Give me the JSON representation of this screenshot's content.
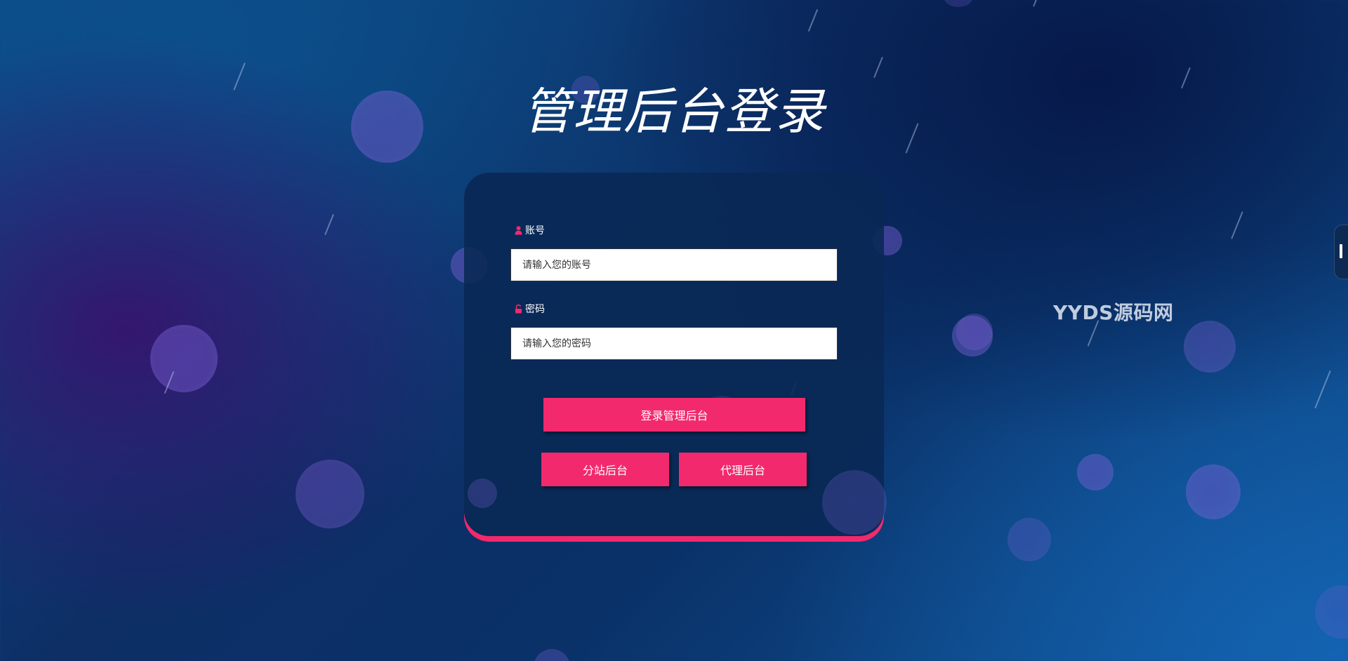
{
  "page": {
    "title": "管理后台登录",
    "watermark": "YYDS源码网"
  },
  "form": {
    "account_label": "账号",
    "account_placeholder": "请输入您的账号",
    "account_value": "",
    "password_label": "密码",
    "password_placeholder": "请输入您的密码",
    "password_value": ""
  },
  "buttons": {
    "login": "登录管理后台",
    "substation": "分站后台",
    "agent": "代理后台"
  },
  "icons": {
    "account": "user-icon",
    "password": "lock-icon"
  },
  "colors": {
    "accent": "#f2296d",
    "card_background": "#092854",
    "input_background": "#ffffff"
  }
}
